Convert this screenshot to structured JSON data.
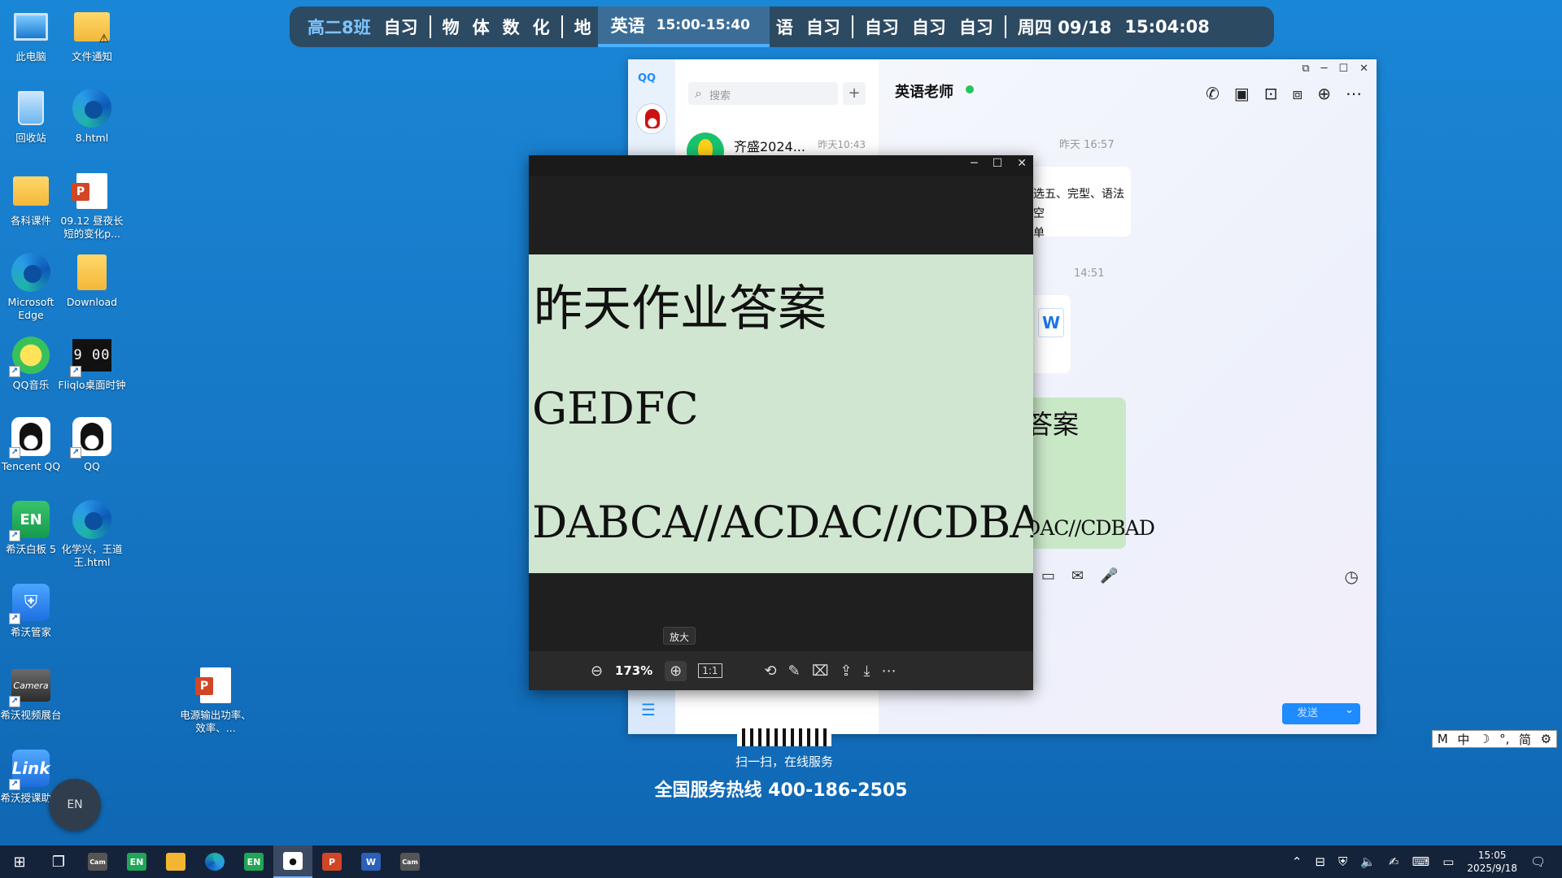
{
  "schedule": {
    "class_name": "高二8班",
    "items": [
      "自习",
      "物",
      "体",
      "数",
      "化",
      "地"
    ],
    "active_subject": "英语",
    "active_time": "15:00-15:40",
    "after_items": [
      "语",
      "自习",
      "自习",
      "自习",
      "自习"
    ],
    "weekday_date": "周四 09/18",
    "time": "15:04:08"
  },
  "desktop_icons": [
    {
      "label": "此电脑",
      "icon": "computer-icon"
    },
    {
      "label": "文件通知",
      "icon": "folder-warning-icon"
    },
    {
      "label": "回收站",
      "icon": "recycle-bin-icon"
    },
    {
      "label": "8.html",
      "icon": "edge-icon"
    },
    {
      "label": "各科课件",
      "icon": "folder-icon"
    },
    {
      "label": "09.12 昼夜长短的变化p...",
      "icon": "ppt-file-icon"
    },
    {
      "label": "Microsoft Edge",
      "icon": "edge-icon"
    },
    {
      "label": "Download",
      "icon": "folder-icon"
    },
    {
      "label": "QQ音乐",
      "icon": "qq-music-icon"
    },
    {
      "label": "Fliqlo桌面时钟",
      "icon": "fliqlo-icon"
    },
    {
      "label": "Tencent QQ",
      "icon": "qq-icon"
    },
    {
      "label": "QQ",
      "icon": "qq-icon"
    },
    {
      "label": "希沃白板 5",
      "icon": "easinote-icon"
    },
    {
      "label": "化学兴，王道王.html",
      "icon": "edge-icon"
    },
    {
      "label": "希沃管家",
      "icon": "seewo-guard-icon"
    },
    {
      "label": "希沃视频展台",
      "icon": "camera-icon"
    },
    {
      "label": "电源输出功率、效率、...",
      "icon": "ppt-file-icon"
    },
    {
      "label": "希沃授课助手",
      "icon": "seewo-link-icon"
    }
  ],
  "qq": {
    "brand": "QQ",
    "search_placeholder": "搜索",
    "conversation": {
      "name": "齐盛2024...",
      "time": "昨天10:43"
    },
    "chat_title": "英语老师",
    "timestamp1": "昨天 16:57",
    "message1_line1": "七选五、完型、语法填空",
    "message1_line2": "清单",
    "timestamp2": "14:51",
    "file_badge": "W",
    "image_msg_line1": "业答案",
    "image_msg_line3": "ACDAC//CDBAD",
    "send_label": "发送"
  },
  "viewer": {
    "line1": "昨天作业答案",
    "line2": "GEDFC",
    "line3": "DABCA//ACDAC//CDBAD",
    "tooltip": "放大",
    "zoom": "173%",
    "actual_size_label": "1:1"
  },
  "service": {
    "scan": "扫一扫，在线服务",
    "hotline": "全国服务热线 400-186-2505"
  },
  "ime": {
    "mode": "M",
    "lang": "中",
    "simp": "简"
  },
  "float_ball": "EN",
  "taskbar": {
    "time": "15:05",
    "date": "2025/9/18"
  }
}
